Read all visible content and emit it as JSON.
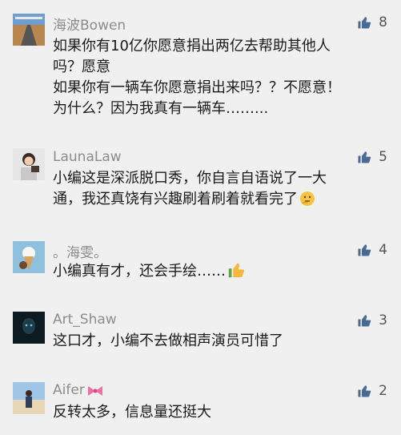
{
  "comments": [
    {
      "username": "海波Bowen",
      "likes": "8",
      "lines": [
        "如果你有10亿你愿意捐出两亿去帮助其他人",
        "吗？愿意",
        "如果你有一辆车你愿意捐出来吗？？不愿意！",
        "为什么？因为我真有一辆车……..."
      ],
      "avatar_icon": "desert-road-icon"
    },
    {
      "username": "LaunaLaw",
      "likes": "5",
      "lines": [
        "小编这是深派脱口秀，你自言自语说了一大",
        "通，我还真饶有兴趣刷着刷着就看完了"
      ],
      "avatar_icon": "girl-icon",
      "trailing_emoji": "thinking-face-emoji"
    },
    {
      "username": "。海雯。",
      "likes": "4",
      "lines": [
        "小编真有才，还会手绘……"
      ],
      "avatar_icon": "ice-cream-icon",
      "trailing_emoji": "thumbs-up-emoji"
    },
    {
      "username": "Art_Shaw",
      "likes": "3",
      "lines": [
        "这口才，小编不去做相声演员可惜了"
      ],
      "avatar_icon": "dark-figure-icon"
    },
    {
      "username": "Aifer",
      "likes": "2",
      "lines": [
        "反转太多，信息量还挺大"
      ],
      "avatar_icon": "beach-person-icon",
      "trailing_emoji": "ribbon-emoji"
    }
  ],
  "colors": {
    "like_icon": "#4a6a95",
    "username": "#8c8c8c",
    "text": "#1a1a1a",
    "background": "#f0f0f0"
  }
}
